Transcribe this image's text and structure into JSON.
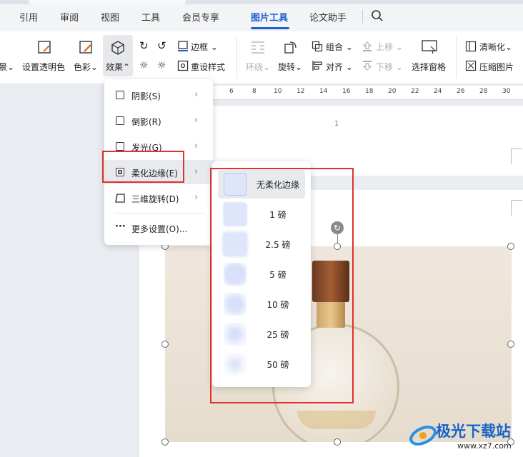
{
  "menu_tabs": [
    {
      "label": "引用",
      "active": false
    },
    {
      "label": "审阅",
      "active": false
    },
    {
      "label": "视图",
      "active": false
    },
    {
      "label": "工具",
      "active": false
    },
    {
      "label": "会员专享",
      "active": false
    },
    {
      "label": "图片工具",
      "active": true
    },
    {
      "label": "论文助手",
      "active": false
    }
  ],
  "ribbon": {
    "partial_left": "景",
    "set_transparent": "设置透明色",
    "color": "色彩",
    "effects": "效果",
    "border": "边框",
    "reset_style": "重设样式",
    "wrap": "环绕",
    "rotate": "旋转",
    "group": "组合",
    "align": "对齐",
    "bring_forward": "上移",
    "send_backward": "下移",
    "selection_pane": "选择窗格",
    "sharpen": "清晰化",
    "compress": "压缩图片"
  },
  "ruler": [
    "6",
    "8",
    "10",
    "12",
    "14",
    "16",
    "18",
    "20",
    "22",
    "24",
    "26",
    "28",
    "30"
  ],
  "page_number": "1",
  "effects_menu": {
    "items": [
      {
        "label": "阴影(S)",
        "submenu": true
      },
      {
        "label": "倒影(R)",
        "submenu": true
      },
      {
        "label": "发光(G)",
        "submenu": true
      },
      {
        "label": "柔化边缘(E)",
        "submenu": true,
        "highlighted": true
      },
      {
        "label": "三维旋转(D)",
        "submenu": true
      },
      {
        "label": "更多设置(O)...",
        "submenu": false
      }
    ]
  },
  "soft_edge_submenu": {
    "items": [
      {
        "label": "无柔化边缘",
        "selected": true,
        "blur": 0
      },
      {
        "label": "1 磅",
        "selected": false,
        "blur": 1
      },
      {
        "label": "2.5 磅",
        "selected": false,
        "blur": 2.5
      },
      {
        "label": "5 磅",
        "selected": false,
        "blur": 5
      },
      {
        "label": "10 磅",
        "selected": false,
        "blur": 10
      },
      {
        "label": "25 磅",
        "selected": false,
        "blur": 25
      },
      {
        "label": "50 磅",
        "selected": false,
        "blur": 50
      }
    ]
  },
  "watermark": {
    "name": "极光下载站",
    "url": "www.xz7.com"
  },
  "colors": {
    "accent": "#1f5fd6",
    "highlight_box": "#e0312b"
  }
}
